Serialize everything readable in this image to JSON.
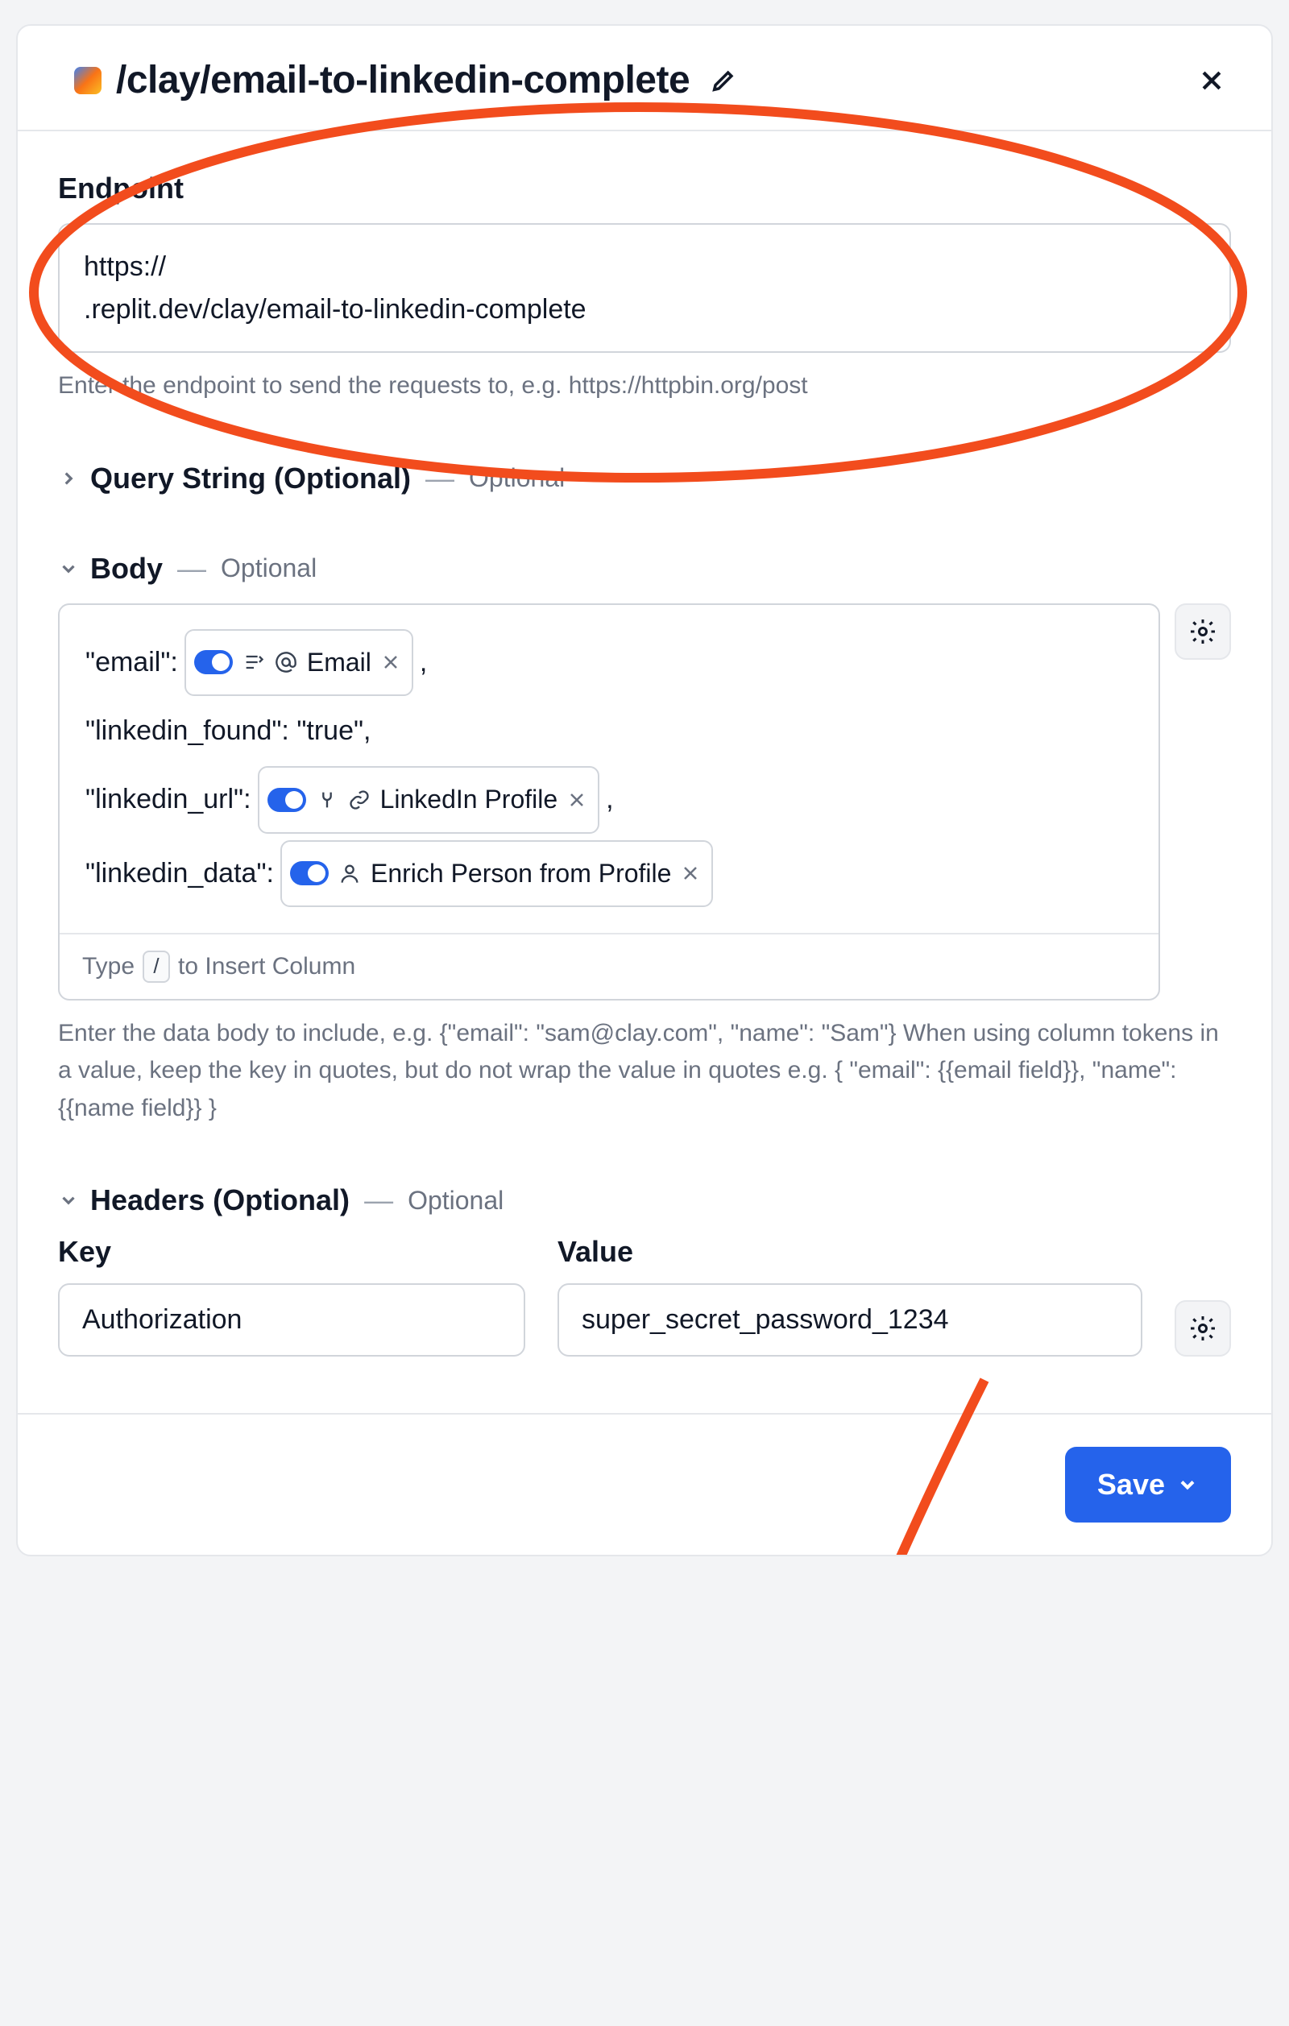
{
  "header": {
    "title": "/clay/email-to-linkedin-complete"
  },
  "endpoint": {
    "label": "Endpoint",
    "url_prefix": "https://",
    "url_redacted_mid": "                                                    -",
    "url_redacted_start": "            ",
    "url_suffix": ".replit.dev/clay/email-to-linkedin-complete",
    "helper": "Enter the endpoint to send the requests to, e.g. https://httpbin.org/post"
  },
  "query_string": {
    "label": "Query String (Optional)",
    "optional_tag": "Optional"
  },
  "body": {
    "label": "Body",
    "optional_tag": "Optional",
    "rows": [
      {
        "key": "\"email\":",
        "token": "Email",
        "trailing": ","
      },
      {
        "key": "\"linkedin_found\": \"true\",",
        "token": null,
        "trailing": ""
      },
      {
        "key": "\"linkedin_url\":",
        "token": "LinkedIn Profile",
        "trailing": ","
      },
      {
        "key": "\"linkedin_data\":",
        "token": "Enrich Person from Profile",
        "trailing": ""
      }
    ],
    "footer_pre": "Type",
    "footer_key": "/",
    "footer_post": "to Insert Column",
    "helper": "Enter the data body to include, e.g. {\"email\": \"sam@clay.com\", \"name\": \"Sam\"} When using column tokens in a value, keep the key in quotes, but do not wrap the value in quotes e.g. { \"email\": {{email field}}, \"name\": {{name field}} }"
  },
  "headers": {
    "label": "Headers (Optional)",
    "optional_tag": "Optional",
    "key_label": "Key",
    "value_label": "Value",
    "row": {
      "key": "Authorization",
      "value": "super_secret_password_1234"
    }
  },
  "footer": {
    "save_label": "Save"
  }
}
